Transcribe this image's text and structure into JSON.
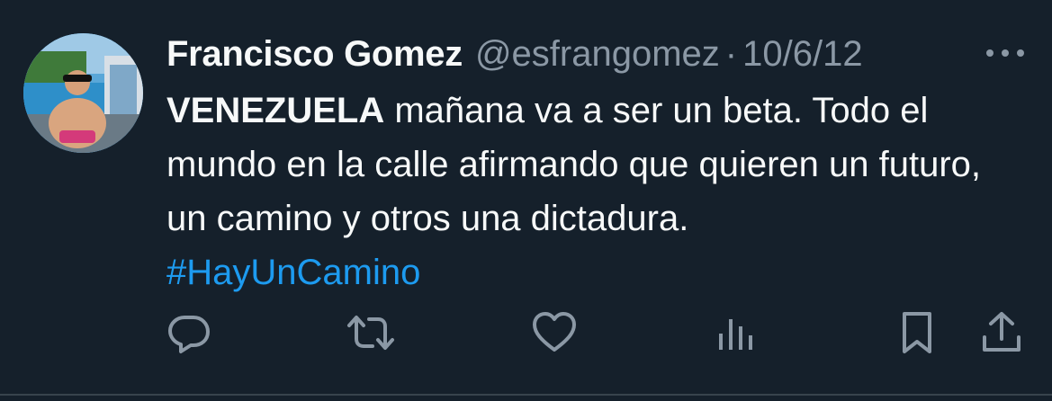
{
  "tweet": {
    "author_name": "Francisco Gomez",
    "handle": "@esfrangomez",
    "separator": "·",
    "date": "10/6/12",
    "text_bold": "VENEZUELA",
    "text_rest": " mañana va a ser un beta. Todo el mundo en la calle afirmando que quieren un futuro, un camino y otros una dictadura.",
    "hashtag": "#HayUnCamino"
  },
  "actions": {
    "reply_icon": "reply-icon",
    "retweet_icon": "retweet-icon",
    "like_icon": "heart-icon",
    "views_icon": "views-icon",
    "bookmark_icon": "bookmark-icon",
    "share_icon": "share-icon"
  },
  "colors": {
    "background": "#15202b",
    "primary_text": "#f7f9f9",
    "secondary_text": "#8b98a5",
    "link": "#1d9bf0"
  }
}
